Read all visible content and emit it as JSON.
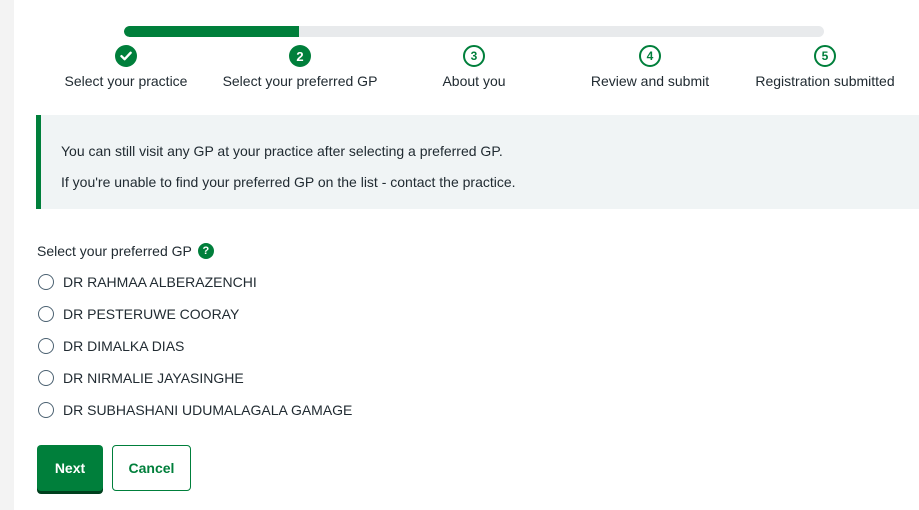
{
  "progress": {
    "fraction": 0.25
  },
  "stepper": {
    "steps": [
      {
        "number": "",
        "label": "Select your practice",
        "state": "done"
      },
      {
        "number": "2",
        "label": "Select your preferred GP",
        "state": "current"
      },
      {
        "number": "3",
        "label": "About you",
        "state": "todo"
      },
      {
        "number": "4",
        "label": "Review and submit",
        "state": "todo"
      },
      {
        "number": "5",
        "label": "Registration submitted",
        "state": "todo"
      }
    ]
  },
  "inset": {
    "line1": "You can still visit any GP at your practice after selecting a preferred GP.",
    "line2": "If you're unable to find your preferred GP on the list - contact the practice."
  },
  "form": {
    "legend": "Select your preferred GP",
    "help_icon": "?",
    "options": [
      "DR RAHMAA ALBERAZENCHI",
      "DR PESTERUWE COORAY",
      "DR DIMALKA DIAS",
      "DR NIRMALIE JAYASINGHE",
      "DR SUBHASHANI UDUMALAGALA GAMAGE"
    ]
  },
  "buttons": {
    "next": "Next",
    "cancel": "Cancel"
  },
  "colors": {
    "brand_green": "#007f3b",
    "text": "#212b32",
    "inset_bg": "#f0f4f5"
  }
}
